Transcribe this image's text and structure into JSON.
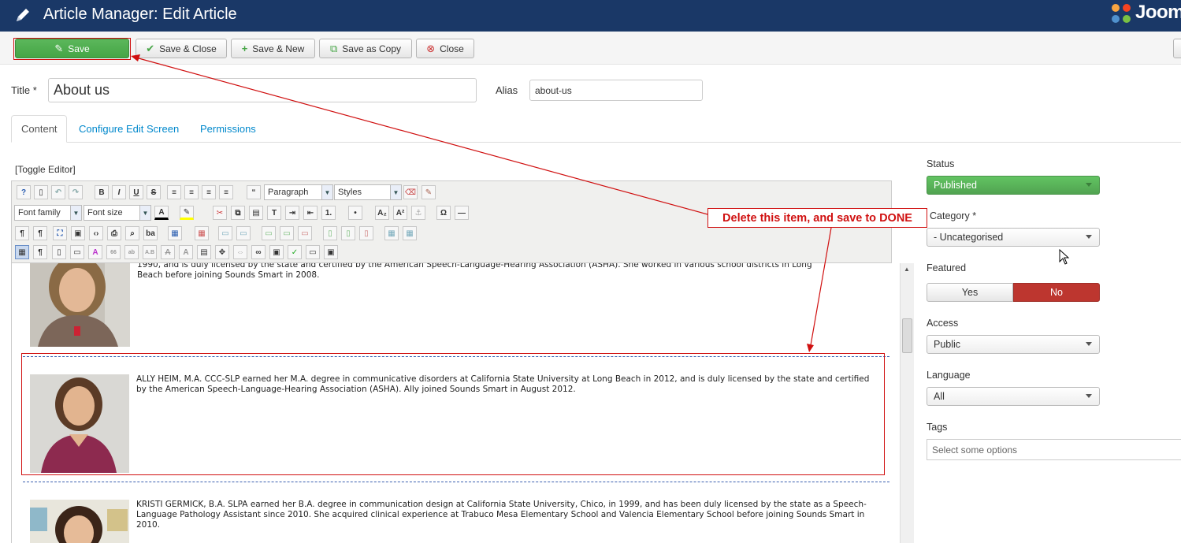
{
  "header": {
    "title": "Article Manager: Edit Article",
    "logo_text": "Joom"
  },
  "toolbar": {
    "save": "Save",
    "save_close": "Save & Close",
    "save_new": "Save & New",
    "save_copy": "Save as Copy",
    "close": "Close"
  },
  "form": {
    "title_label": "Title *",
    "title_value": "About us",
    "alias_label": "Alias",
    "alias_value": "about-us"
  },
  "tabs": [
    "Content",
    "Configure Edit Screen",
    "Permissions"
  ],
  "editor": {
    "toggle": "[Toggle Editor]",
    "format_select": "Paragraph",
    "styles_select": "Styles",
    "font_family": "Font family",
    "font_size": "Font size"
  },
  "content": {
    "bio1_partial_line1": "1990, and is duly licensed by the state and certified by the American Speech-Language-Hearing Association (ASHA). She worked in various school districts in Long",
    "bio1_partial_line2": "Beach before joining Sounds Smart in 2008.",
    "bio2": "ALLY HEIM, M.A. CCC-SLP earned her M.A. degree in communicative disorders at California State University at Long Beach in 2012, and is duly licensed by the state and certified by the American Speech-Language-Hearing Association (ASHA). Ally joined Sounds Smart in August 2012.",
    "bio3": "KRISTI GERMICK, B.A. SLPA earned her B.A. degree in communication design at California State University, Chico, in 1999, and has been duly licensed by the state as a Speech-Language Pathology Assistant since 2010. She acquired clinical experience at Trabuco Mesa Elementary School and Valencia Elementary School before joining Sounds Smart in 2010."
  },
  "sidebar": {
    "status_label": "Status",
    "status_value": "Published",
    "category_label": "Category *",
    "category_value": "- Uncategorised",
    "featured_label": "Featured",
    "featured_yes": "Yes",
    "featured_no": "No",
    "access_label": "Access",
    "access_value": "Public",
    "language_label": "Language",
    "language_value": "All",
    "tags_label": "Tags",
    "tags_placeholder": "Select some options"
  },
  "annotation": {
    "text": "Delete this item, and save to DONE"
  },
  "colors": {
    "header_bg": "#1a3867",
    "save_green": "#46a546",
    "status_green": "#51a351",
    "featured_no_red": "#bd362f",
    "annotation_red": "#d01010",
    "link_blue": "#0088cc"
  }
}
